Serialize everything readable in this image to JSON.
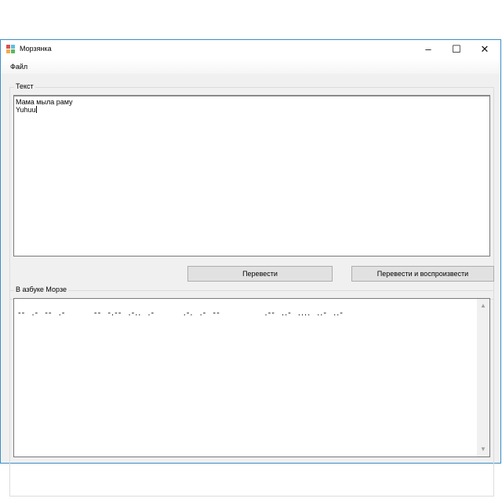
{
  "window": {
    "title": "Морзянка"
  },
  "menu": {
    "file": "Файл"
  },
  "input_group": {
    "label": "Текст",
    "text": "Мама мыла раму\nYuhuu"
  },
  "buttons": {
    "translate": "Перевести",
    "translate_play": "Перевести и воспроизвести"
  },
  "output_group": {
    "label": "В азбуке Морзе",
    "morse": "--  .-  --  .-         --  -.--  .-..  .-         .-.  .-  --              .--  ..-  ....  ..-  ..-"
  },
  "icons": {
    "minimize": "minimize-icon",
    "maximize": "maximize-icon",
    "close": "close-icon"
  }
}
